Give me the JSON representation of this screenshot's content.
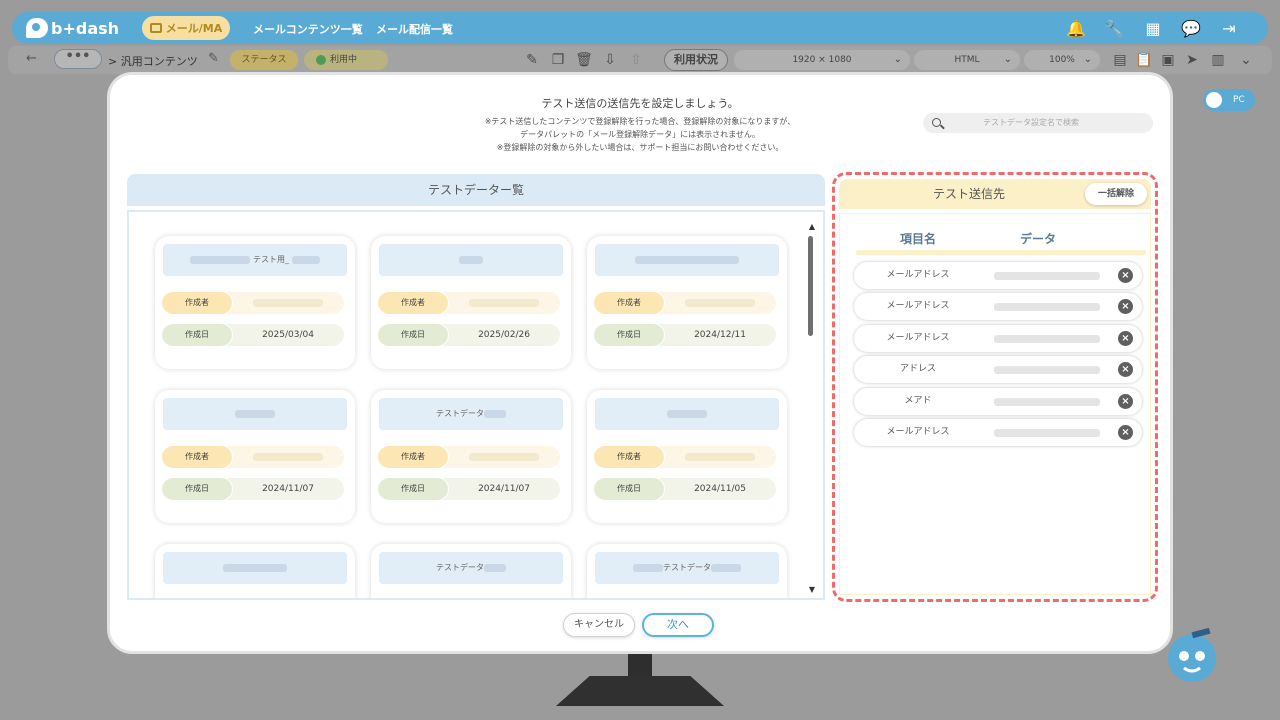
{
  "app": {
    "logo_text": "b+dash",
    "mode_label": "メール/MA",
    "nav": [
      "メールコンテンツ一覧",
      "メール配信一覧"
    ]
  },
  "subbar": {
    "dots": "•••",
    "breadcrumb": "> 汎用コンテンツ",
    "status_label": "ステータス",
    "status_value": "利用中",
    "usage_label": "利用状況",
    "resolution": "1920 × 1080",
    "format": "HTML",
    "zoom": "100%"
  },
  "pc_toggle": "PC",
  "modal": {
    "title": "テスト送信の送信先を設定しましょう。",
    "notes": [
      "※テスト送信したコンテンツで登録解除を行った場合、登録解除の対象になりますが、",
      "データパレットの「メール登録解除データ」には表示されません。",
      "※登録解除の対象から外したい場合は、サポート担当にお問い合わせください。"
    ],
    "search_placeholder": "テストデータ設定名で検索",
    "list_title": "テストデーター覧",
    "creator_label": "作成者",
    "date_label": "作成日",
    "cards": [
      {
        "title": "テスト用_",
        "date": "2025/03/04"
      },
      {
        "title": "",
        "date": "2025/02/26"
      },
      {
        "title": "",
        "date": "2024/12/11"
      },
      {
        "title": "",
        "date": "2024/11/07"
      },
      {
        "title": "テストデータ",
        "date": "2024/11/07"
      },
      {
        "title": "",
        "date": "2024/11/05"
      },
      {
        "title": "",
        "date": ""
      },
      {
        "title": "テストデータ",
        "date": ""
      },
      {
        "title": "テストデータ",
        "date": ""
      }
    ],
    "right_title": "テスト送信先",
    "bulk_remove": "一括解除",
    "col_item": "項目名",
    "col_data": "データ",
    "recipients": [
      "メールアドレス",
      "メールアドレス",
      "メールアドレス",
      "アドレス",
      "メアド",
      "メールアドレス"
    ],
    "cancel": "キャンセル",
    "next": "次へ"
  }
}
